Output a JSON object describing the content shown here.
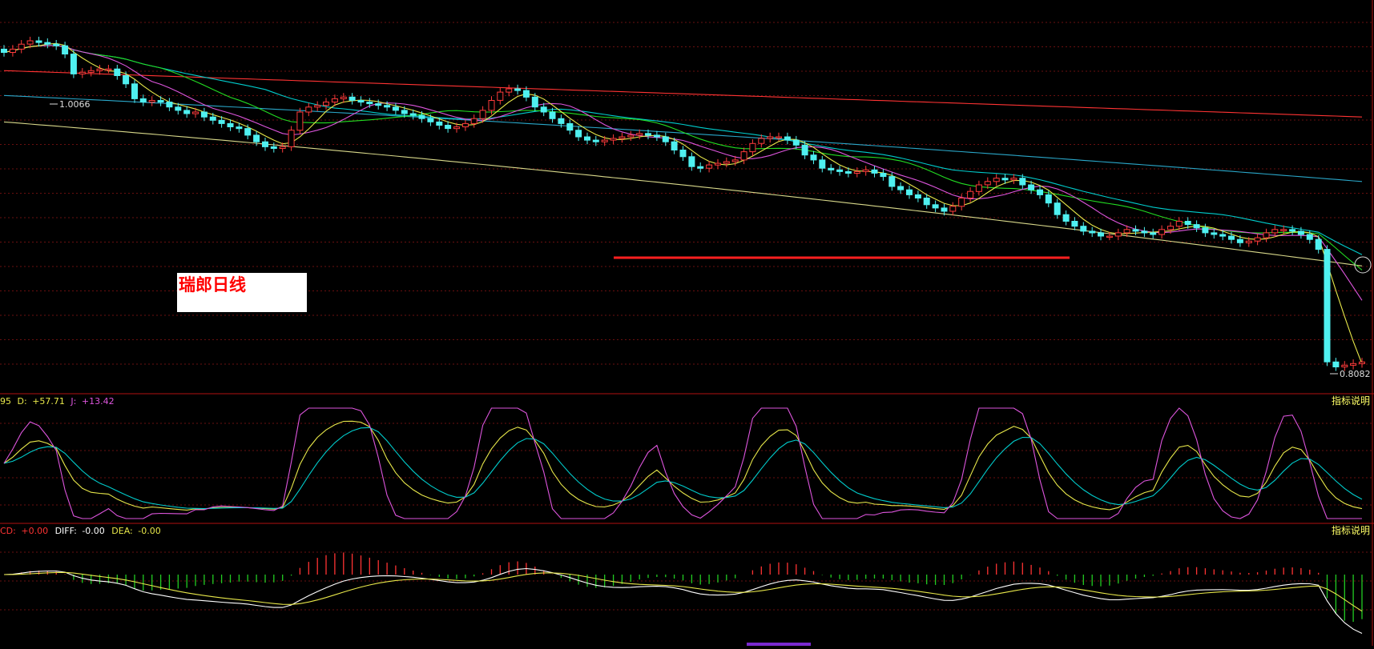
{
  "chart_data": [
    {
      "type": "candlestick",
      "panel": "price",
      "annotation_box": "瑞郎日线",
      "max_label": "1.0066",
      "min_label": "0.8082",
      "moving_averages": [
        {
          "color": "#ff3333",
          "start": 0.987,
          "end": 0.959,
          "kind": "straight"
        },
        {
          "color": "#2aa7c9",
          "start": 0.972,
          "end": 0.92,
          "kind": "curve"
        },
        {
          "color": "#d8d88a",
          "start": 0.956,
          "end": 0.869,
          "kind": "curve"
        },
        {
          "color": "#00cccc",
          "start": 0.931,
          "end": 0.839,
          "kind": "follow",
          "smooth": 30
        },
        {
          "color": "#22dd22",
          "start": 0.935,
          "end": 0.832,
          "kind": "follow",
          "smooth": 18
        },
        {
          "color": "#dd55dd",
          "start": 0.932,
          "end": 0.829,
          "kind": "follow",
          "smooth": 9
        },
        {
          "color": "#e8e84a",
          "start": 0.935,
          "end": 0.824,
          "kind": "follow",
          "smooth": 4
        }
      ],
      "candles_close": [
        0.998,
        1.0,
        1.003,
        1.005,
        1.004,
        1.003,
        1.002,
        0.997,
        0.985,
        0.986,
        0.987,
        0.988,
        0.988,
        0.984,
        0.979,
        0.97,
        0.968,
        0.969,
        0.968,
        0.965,
        0.963,
        0.961,
        0.962,
        0.959,
        0.957,
        0.955,
        0.953,
        0.952,
        0.948,
        0.944,
        0.941,
        0.94,
        0.941,
        0.951,
        0.962,
        0.965,
        0.966,
        0.968,
        0.97,
        0.971,
        0.969,
        0.968,
        0.967,
        0.966,
        0.965,
        0.963,
        0.961,
        0.96,
        0.958,
        0.956,
        0.954,
        0.952,
        0.953,
        0.955,
        0.958,
        0.963,
        0.969,
        0.974,
        0.976,
        0.975,
        0.971,
        0.965,
        0.962,
        0.958,
        0.955,
        0.951,
        0.947,
        0.945,
        0.944,
        0.945,
        0.946,
        0.947,
        0.948,
        0.949,
        0.948,
        0.947,
        0.944,
        0.939,
        0.935,
        0.929,
        0.928,
        0.93,
        0.931,
        0.932,
        0.933,
        0.938,
        0.943,
        0.946,
        0.947,
        0.947,
        0.945,
        0.942,
        0.936,
        0.933,
        0.928,
        0.927,
        0.926,
        0.925,
        0.926,
        0.927,
        0.925,
        0.923,
        0.917,
        0.915,
        0.912,
        0.91,
        0.906,
        0.904,
        0.902,
        0.905,
        0.91,
        0.914,
        0.918,
        0.92,
        0.922,
        0.921,
        0.922,
        0.918,
        0.915,
        0.912,
        0.907,
        0.9,
        0.896,
        0.893,
        0.89,
        0.889,
        0.887,
        0.887,
        0.889,
        0.891,
        0.89,
        0.889,
        0.888,
        0.891,
        0.893,
        0.896,
        0.894,
        0.892,
        0.889,
        0.888,
        0.887,
        0.885,
        0.883,
        0.884,
        0.886,
        0.889,
        0.891,
        0.891,
        0.89,
        0.888,
        0.885,
        0.879,
        0.811,
        0.808,
        0.809,
        0.81,
        0.811
      ],
      "xlabel": "",
      "ylabel": ""
    },
    {
      "type": "line",
      "panel": "kdj",
      "header_prefix": "95",
      "header": [
        {
          "label": "D:",
          "value": "+57.71",
          "color": "#e8e84a"
        },
        {
          "label": "J:",
          "value": "+13.42",
          "color": "#dd55dd"
        }
      ],
      "help_text": "指标说明",
      "series_colors": [
        "#e8e84a",
        "#00cccc",
        "#dd55dd"
      ]
    },
    {
      "type": "bar",
      "panel": "macd",
      "header_prefix": "CD:",
      "header": [
        {
          "label": "",
          "value": "+0.00",
          "color": "#ff3333"
        },
        {
          "label": "DIFF:",
          "value": "-0.00",
          "color": "#ffffff"
        },
        {
          "label": "DEA:",
          "value": "-0.00",
          "color": "#e8e84a"
        }
      ],
      "help_text": "指标说明",
      "series_colors": [
        "#ffffff",
        "#e8e84a",
        "#ff3333",
        "#22cc22"
      ]
    }
  ]
}
